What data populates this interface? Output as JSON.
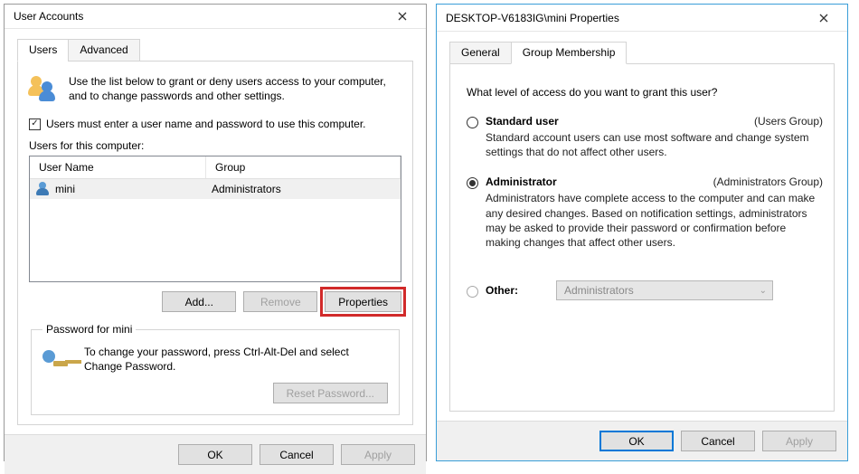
{
  "left": {
    "title": "User Accounts",
    "tabs": {
      "users": "Users",
      "advanced": "Advanced"
    },
    "intro": "Use the list below to grant or deny users access to your computer, and to change passwords and other settings.",
    "require_login_label": "Users must enter a user name and password to use this computer.",
    "users_label": "Users for this computer:",
    "columns": {
      "name": "User Name",
      "group": "Group"
    },
    "rows": [
      {
        "name": "mini",
        "group": "Administrators"
      }
    ],
    "buttons": {
      "add": "Add...",
      "remove": "Remove",
      "properties": "Properties"
    },
    "pw_legend": "Password for mini",
    "pw_text": "To change your password, press Ctrl-Alt-Del and select Change Password.",
    "reset": "Reset Password...",
    "ok": "OK",
    "cancel": "Cancel",
    "apply": "Apply"
  },
  "right": {
    "title": "DESKTOP-V6183IG\\mini Properties",
    "tabs": {
      "general": "General",
      "membership": "Group Membership"
    },
    "question": "What level of access do you want to grant this user?",
    "std_label": "Standard user",
    "std_group": "(Users Group)",
    "std_desc": "Standard account users can use most software and change system settings that do not affect other users.",
    "admin_label": "Administrator",
    "admin_group": "(Administrators Group)",
    "admin_desc": "Administrators have complete access to the computer and can make any desired changes. Based on notification settings, administrators may be asked to provide their password or confirmation before making changes that affect other users.",
    "other_label": "Other:",
    "other_value": "Administrators",
    "ok": "OK",
    "cancel": "Cancel",
    "apply": "Apply"
  }
}
